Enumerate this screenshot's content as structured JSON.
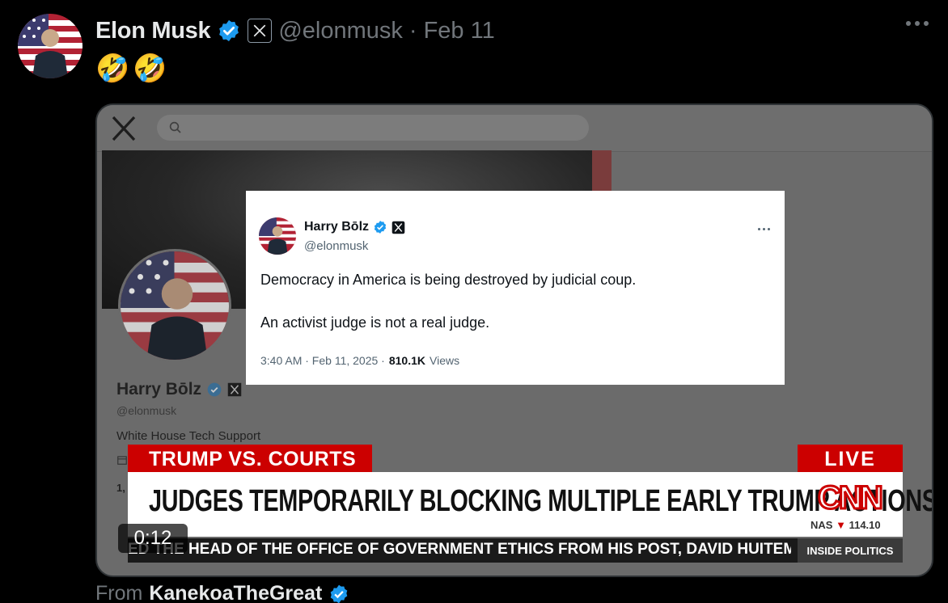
{
  "post": {
    "author_name": "Elon Musk",
    "handle": "@elonmusk",
    "separator": "·",
    "date": "Feb 11",
    "text": "🤣🤣",
    "emojis": [
      "🤣",
      "🤣"
    ],
    "colors": {
      "verified": "#1d9bf0",
      "muted": "#71767b",
      "background": "#000000"
    }
  },
  "video": {
    "timestamp": "0:12",
    "search_icon": "search-icon",
    "profile": {
      "name": "Harry Bōlz",
      "handle": "@elonmusk",
      "bio": "White House Tech Support",
      "partial_count": "1,"
    },
    "embedded_tweet": {
      "name": "Harry Bōlz",
      "handle": "@elonmusk",
      "line1": "Democracy in America is being destroyed by judicial coup.",
      "line2": "An activist judge is not a real judge.",
      "time": "3:40 AM · Feb 11, 2025 ·",
      "views_count": "810.1K",
      "views_label": "Views"
    },
    "cnn": {
      "topic": "TRUMP VS. COURTS",
      "live": "LIVE",
      "headline": "JUDGES TEMPORARILY BLOCKING MULTIPLE EARLY TRUMP ACTIONS",
      "logo": "CNN",
      "market_name": "NAS",
      "market_arrow": "▼",
      "market_value": "114.10",
      "ticker": "ED THE HEAD OF THE OFFICE OF GOVERNMENT ETHICS FROM HIS POST, DAVID HUITEMA",
      "show": "INSIDE POLITICS",
      "colors": {
        "red": "#cc0000"
      }
    }
  },
  "source": {
    "label": "From",
    "name": "KanekoaTheGreat"
  }
}
